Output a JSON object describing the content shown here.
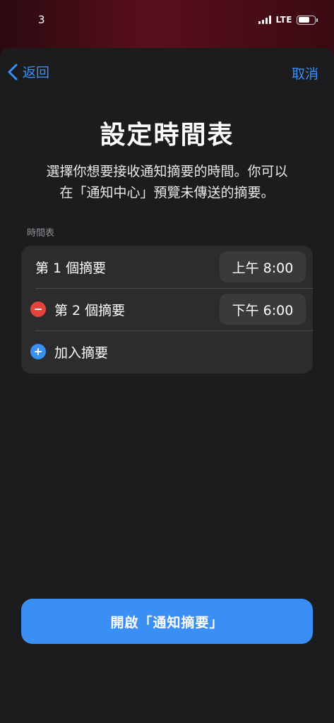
{
  "status_bar": {
    "time": "3",
    "network": "LTE"
  },
  "nav": {
    "back_label": "返回",
    "cancel_label": "取消"
  },
  "title": "設定時間表",
  "subtitle_line1": "選擇你想要接收通知摘要的時間。你可以",
  "subtitle_line2": "在「通知中心」預覽未傳送的摘要。",
  "section_label": "時間表",
  "schedule": {
    "rows": [
      {
        "label": "第 1 個摘要",
        "time": "上午 8:00"
      },
      {
        "label": "第 2 個摘要",
        "time": "下午 6:00"
      }
    ],
    "add_label": "加入摘要"
  },
  "cta_label": "開啟「通知摘要」",
  "colors": {
    "accent": "#3a8ff5",
    "destructive": "#e5443a",
    "background": "#1c1c1e",
    "cell": "#2c2c2e"
  }
}
